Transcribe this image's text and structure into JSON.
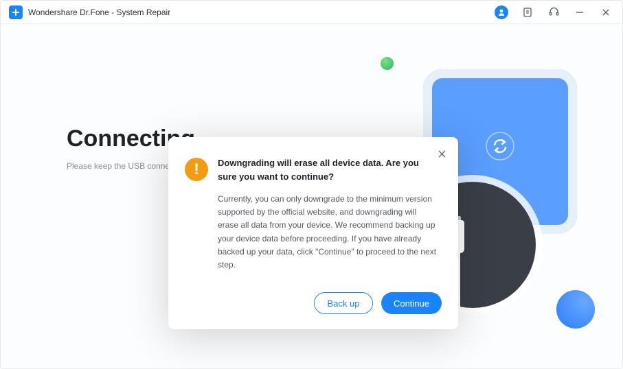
{
  "titlebar": {
    "app_title": "Wondershare Dr.Fone - System Repair"
  },
  "main": {
    "headline": "Connecting...",
    "subline": "Please keep the USB connection"
  },
  "modal": {
    "title": "Downgrading will erase all device data. Are you sure you want to continue?",
    "body": "Currently, you can only downgrade to the minimum version supported by the official website, and downgrading will erase all data from your device. We recommend backing up your device data before proceeding. If you have already backed up your data, click \"Continue\" to proceed to the next step.",
    "backup_label": "Back up",
    "continue_label": "Continue"
  }
}
